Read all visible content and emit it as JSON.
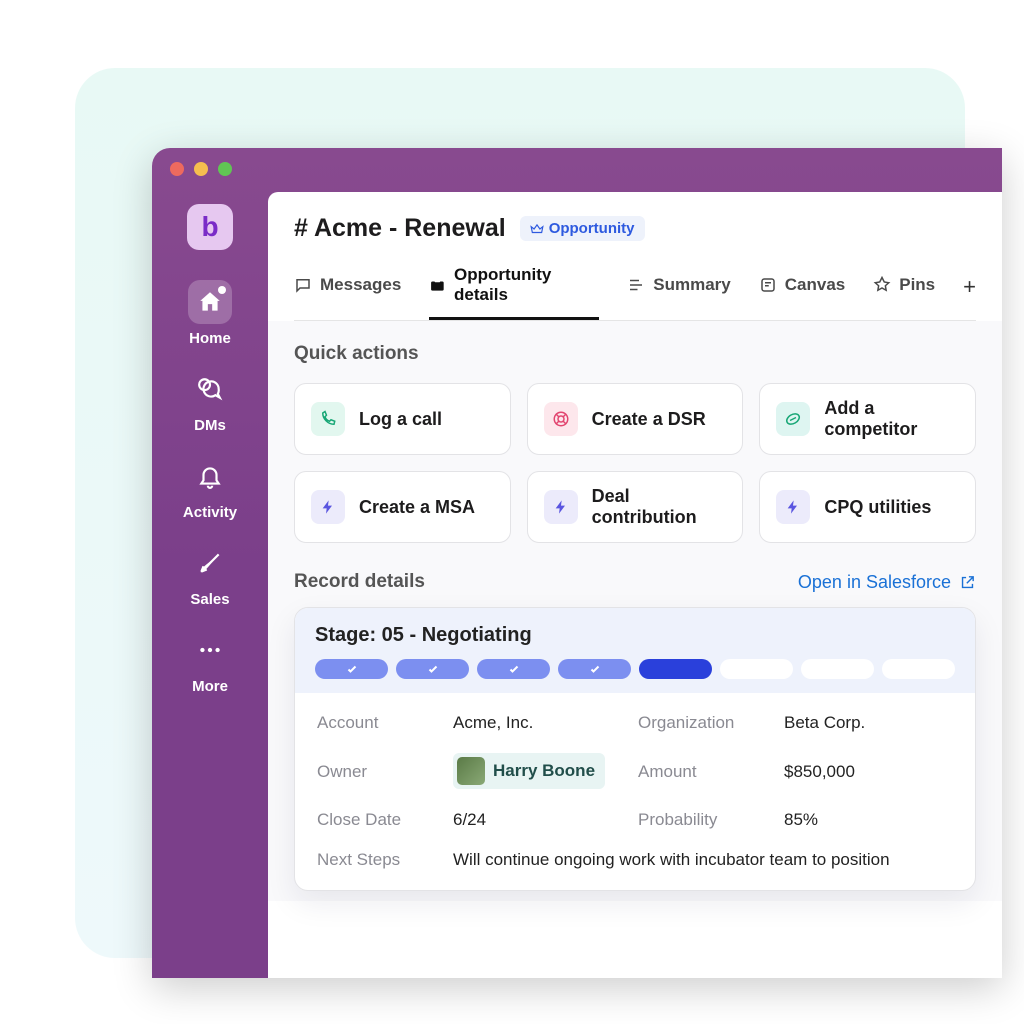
{
  "workspace_letter": "b",
  "sidebar": {
    "items": [
      {
        "label": "Home",
        "icon": "home-icon",
        "active": true,
        "notif": true
      },
      {
        "label": "DMs",
        "icon": "dms-icon"
      },
      {
        "label": "Activity",
        "icon": "bell-icon"
      },
      {
        "label": "Sales",
        "icon": "rocket-icon"
      },
      {
        "label": "More",
        "icon": "ellipsis-icon"
      }
    ]
  },
  "channel": {
    "hash": "#",
    "name": "Acme - Renewal",
    "badge_label": "Opportunity"
  },
  "tabs": [
    {
      "label": "Messages"
    },
    {
      "label": "Opportunity details",
      "active": true
    },
    {
      "label": "Summary"
    },
    {
      "label": "Canvas"
    },
    {
      "label": "Pins"
    }
  ],
  "quick_actions": {
    "title": "Quick actions",
    "items": [
      {
        "label": "Log a call",
        "icon": "phone-icon",
        "tone": "green"
      },
      {
        "label": "Create a DSR",
        "icon": "lifebuoy-icon",
        "tone": "pink"
      },
      {
        "label": "Add a competitor",
        "icon": "football-icon",
        "tone": "teal"
      },
      {
        "label": "Create a MSA",
        "icon": "bolt-icon",
        "tone": "indigo"
      },
      {
        "label": "Deal contribution",
        "icon": "bolt-icon",
        "tone": "indigo"
      },
      {
        "label": "CPQ utilities",
        "icon": "bolt-icon",
        "tone": "indigo"
      }
    ]
  },
  "record": {
    "section_title": "Record details",
    "open_link": "Open in Salesforce",
    "stage_label": "Stage: 05 - Negotiating",
    "stage_pills": [
      "done",
      "done",
      "done",
      "done",
      "current",
      "empty",
      "empty",
      "empty"
    ],
    "fields": {
      "account_k": "Account",
      "account_v": "Acme, Inc.",
      "org_k": "Organization",
      "org_v": "Beta Corp.",
      "owner_k": "Owner",
      "owner_v": "Harry Boone",
      "amount_k": "Amount",
      "amount_v": "$850,000",
      "close_k": "Close Date",
      "close_v": "6/24",
      "prob_k": "Probability",
      "prob_v": "85%",
      "next_k": "Next Steps",
      "next_v": "Will continue ongoing work with incubator team to position"
    }
  }
}
